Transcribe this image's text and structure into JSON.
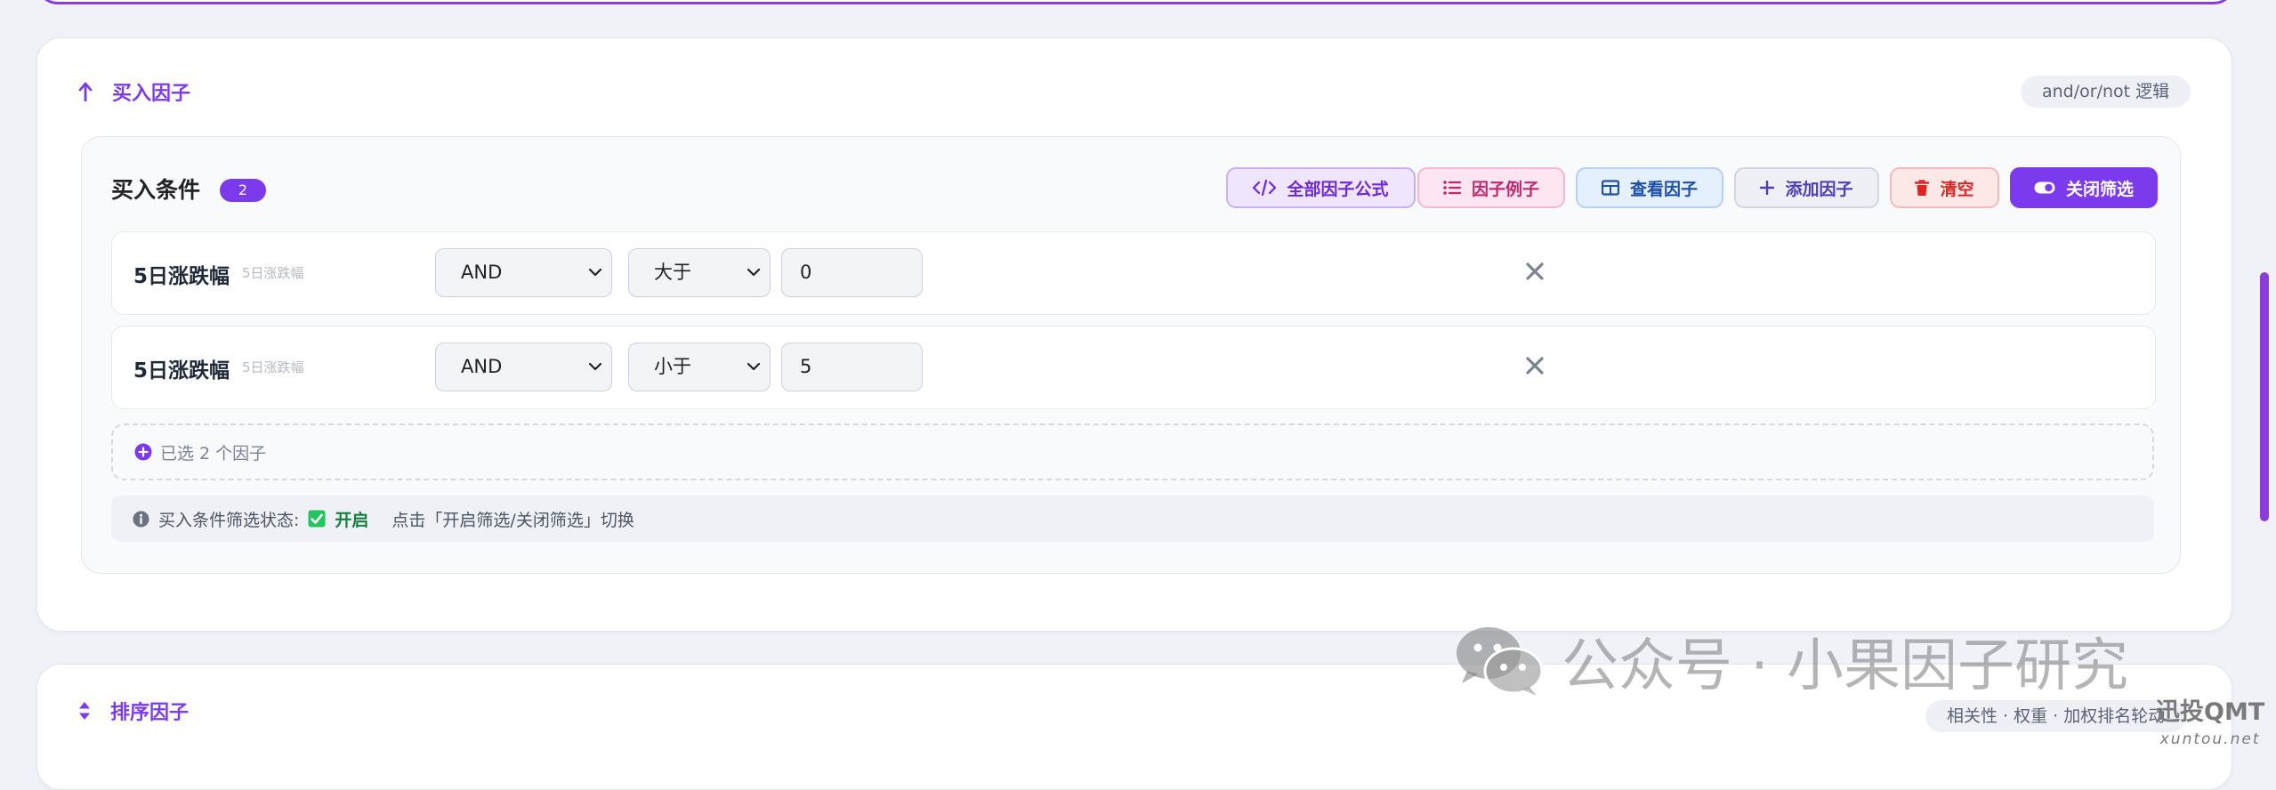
{
  "buy_section": {
    "title": "买入因子",
    "hint": "and/or/not 逻辑",
    "conditions_title": "买入条件",
    "condition_count": "2",
    "toolbar": {
      "all_formulas": "全部因子公式",
      "factor_examples": "因子例子",
      "view_factors": "查看因子",
      "add_factor": "添加因子",
      "clear": "清空",
      "close_filter": "关闭筛选"
    },
    "rows": [
      {
        "name": "5日涨跌幅",
        "sub": "5日涨跌幅",
        "logic": "AND",
        "operator": "大于",
        "value": "0"
      },
      {
        "name": "5日涨跌幅",
        "sub": "5日涨跌幅",
        "logic": "AND",
        "operator": "小于",
        "value": "5"
      }
    ],
    "selected_text": "已选 2 个因子",
    "status": {
      "label": "买入条件筛选状态:",
      "state": "开启",
      "hint": "点击「开启筛选/关闭筛选」切换"
    }
  },
  "sort_section": {
    "title": "排序因子",
    "hint": "相关性 · 权重 · 加权排名轮动"
  },
  "watermark": {
    "text": "公众号 · 小果因子研究",
    "brand": "迅投QMT",
    "brand_url": "xuntou.net"
  },
  "colors": {
    "accent": "#7c3aed",
    "status_on": "#15803d",
    "danger": "#dc2626"
  }
}
